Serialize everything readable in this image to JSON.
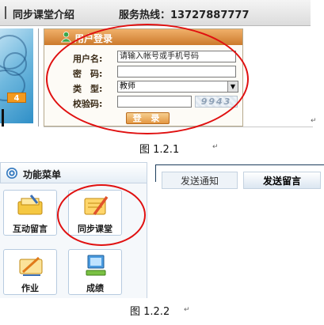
{
  "figure1": {
    "intro_label": "同步课堂介绍",
    "hotline_label": "服务热线：13727887777",
    "badge": "4",
    "login": {
      "title": "用户登录",
      "username_label": "用户名:",
      "username_value": "请输入帐号或手机号码",
      "password_label": "密　码:",
      "type_label": "类　型:",
      "type_value": "教师",
      "captcha_label": "校验码:",
      "captcha_text": "9943",
      "login_button": "登 录"
    },
    "caption": "图 1.2.1"
  },
  "figure2": {
    "menu_title": "功能菜单",
    "tiles": [
      {
        "label": "互动留言"
      },
      {
        "label": "同步课堂"
      },
      {
        "label": "作业"
      },
      {
        "label": "成绩"
      }
    ],
    "tabs": [
      {
        "label": "发送通知",
        "active": false
      },
      {
        "label": "发送留言",
        "active": true
      }
    ],
    "caption": "图 1.2.2"
  },
  "colors": {
    "highlight_circle": "#e01010",
    "login_header": "#cc7a2c",
    "menu_border": "#b7cbe0"
  },
  "paragraph_mark": "↵"
}
